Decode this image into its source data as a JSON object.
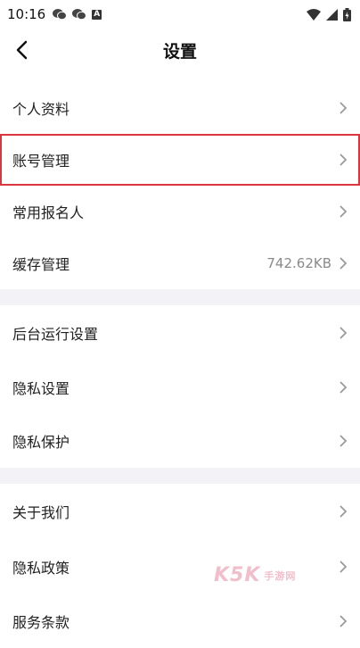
{
  "status_bar": {
    "time": "10:16",
    "notification_icons": [
      "wechat-icon",
      "wechat-icon",
      "a-icon"
    ],
    "right_icons": [
      "wifi-icon",
      "signal-icon",
      "battery-icon"
    ]
  },
  "header": {
    "title": "设置",
    "back_icon": "back-chevron-icon"
  },
  "groups": [
    {
      "items": [
        {
          "label": "个人资料",
          "value": ""
        },
        {
          "label": "账号管理",
          "value": "",
          "highlighted": true
        },
        {
          "label": "常用报名人",
          "value": ""
        },
        {
          "label": "缓存管理",
          "value": "742.62KB"
        }
      ]
    },
    {
      "items": [
        {
          "label": "后台运行设置",
          "value": ""
        },
        {
          "label": "隐私设置",
          "value": ""
        },
        {
          "label": "隐私保护",
          "value": ""
        }
      ]
    },
    {
      "items": [
        {
          "label": "关于我们",
          "value": ""
        },
        {
          "label": "隐私政策",
          "value": ""
        },
        {
          "label": "服务条款",
          "value": ""
        }
      ]
    }
  ],
  "watermark": {
    "text": "K5K",
    "sub": "手游网"
  },
  "colors": {
    "highlight_border": "#d9363e",
    "separator_band": "#f3f2f6",
    "value_text": "#8a8a8a",
    "chevron": "#9a9a9a"
  }
}
